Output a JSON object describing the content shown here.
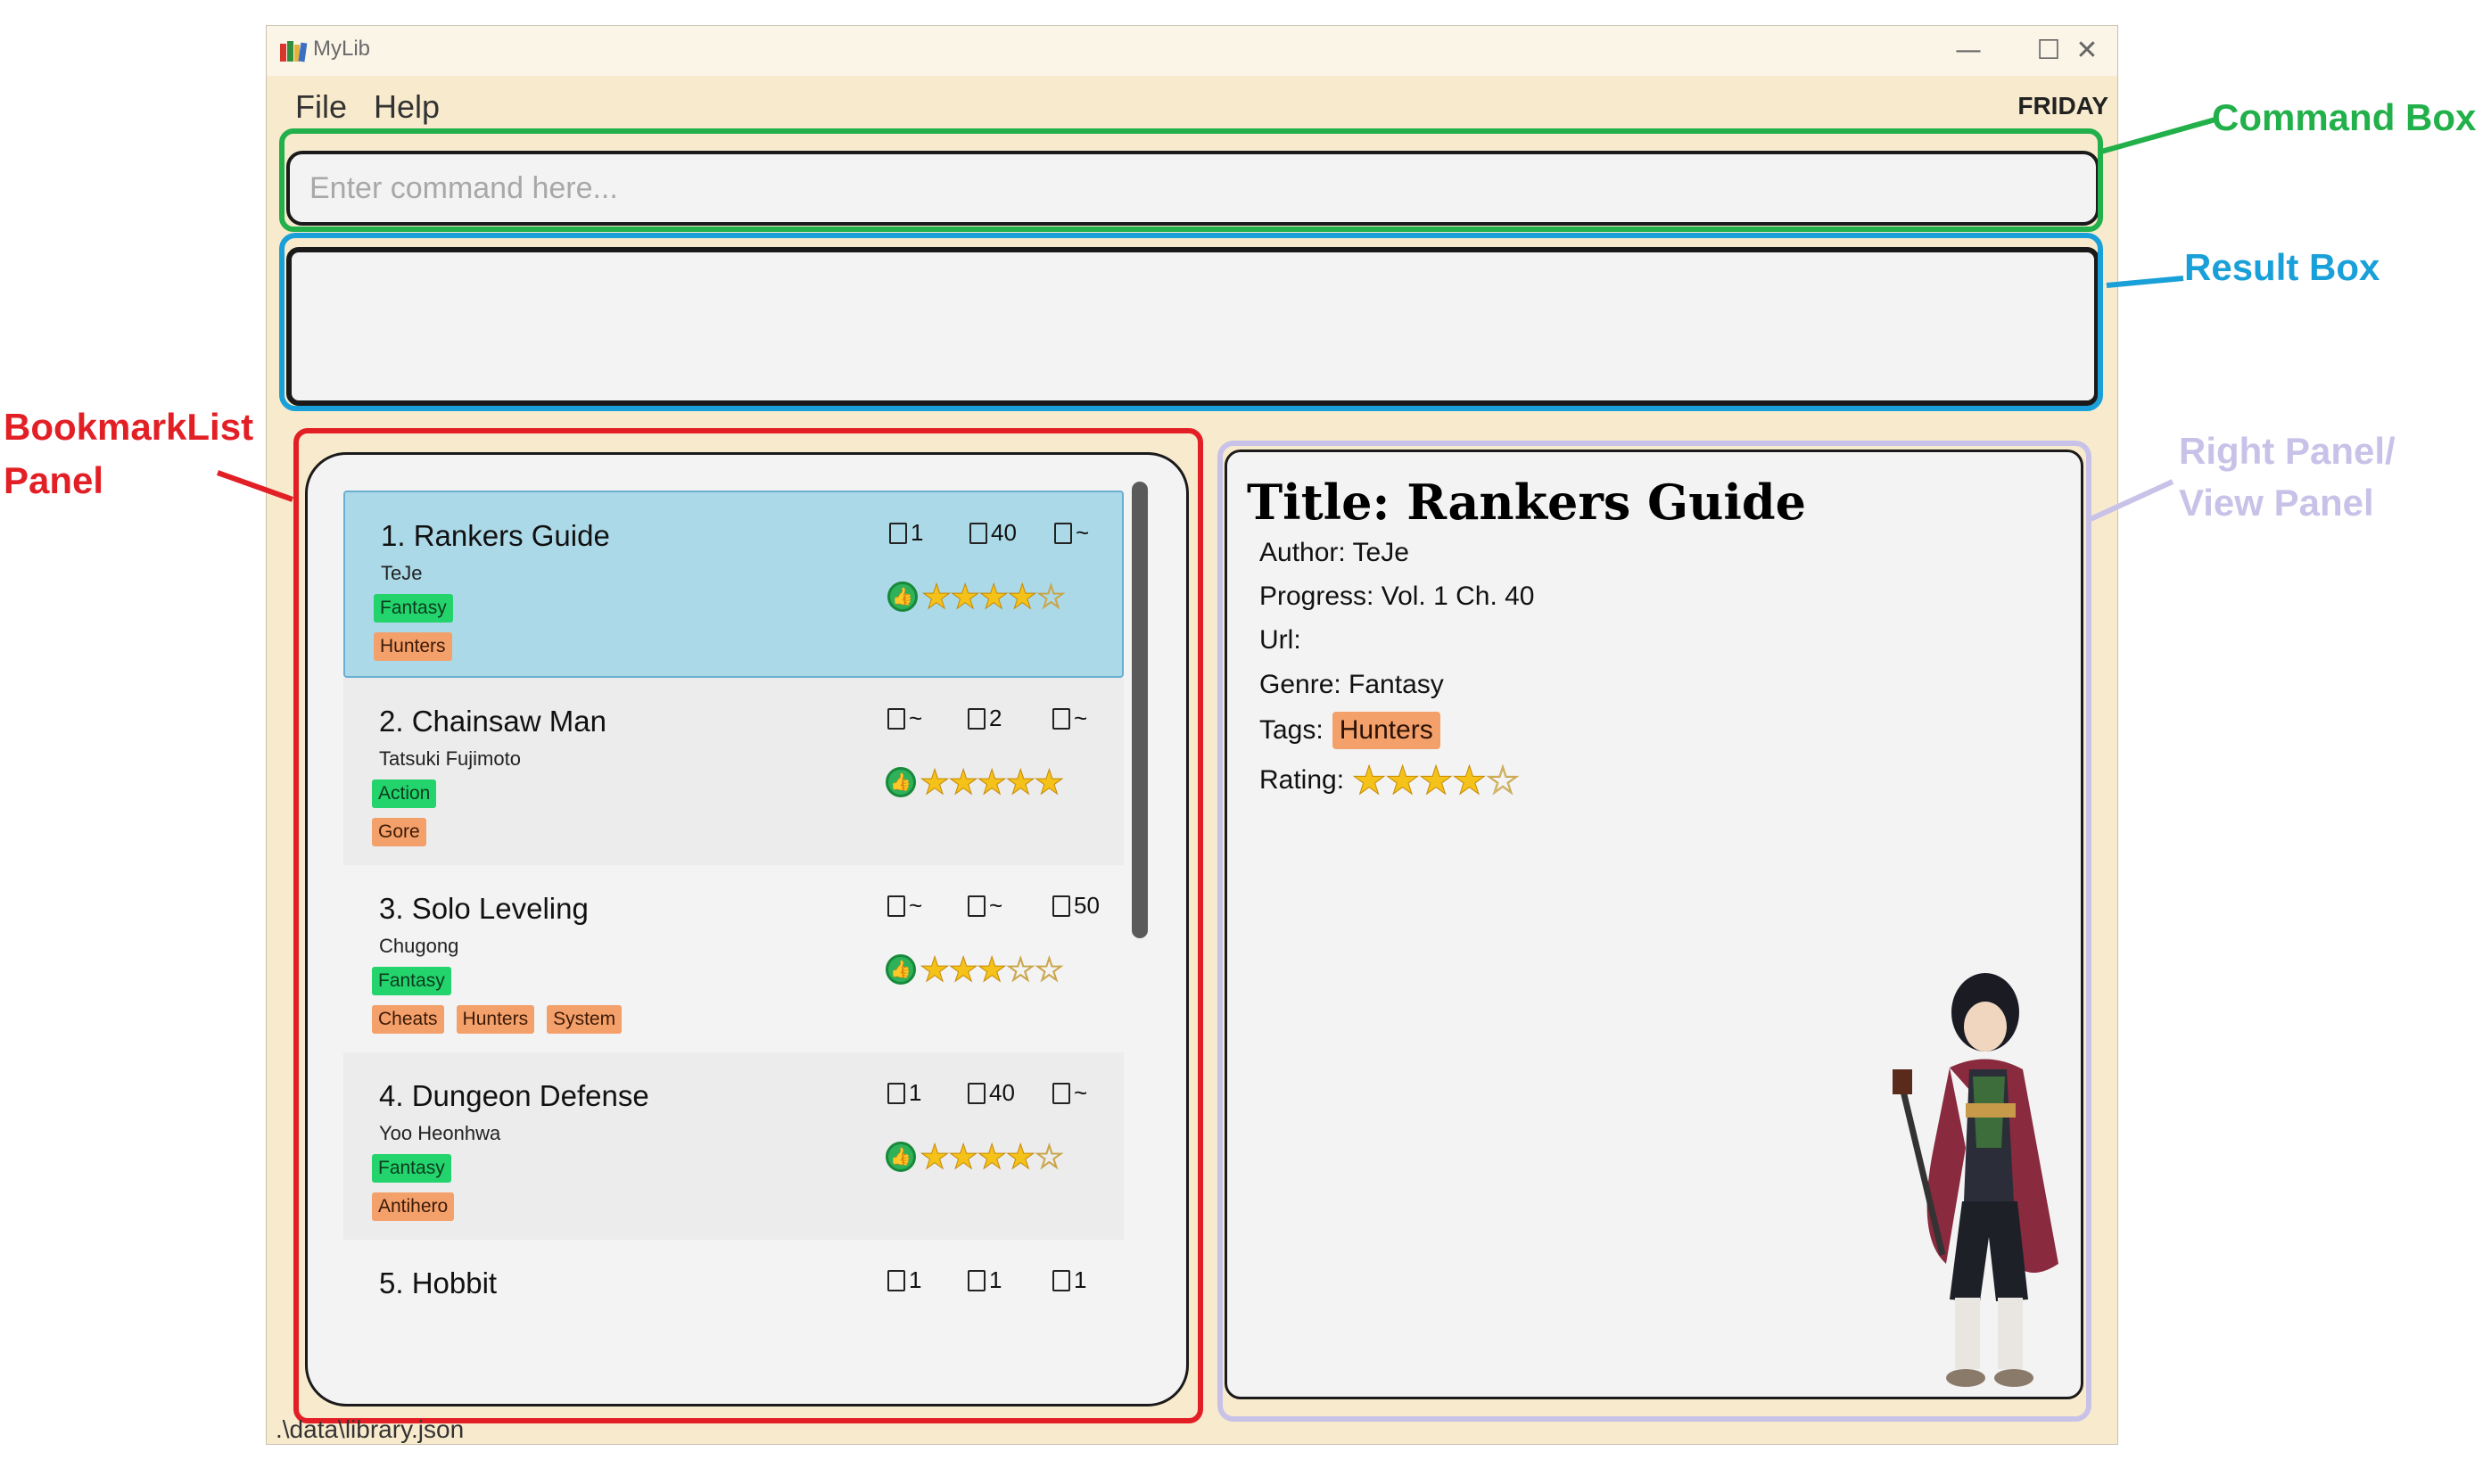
{
  "window": {
    "title": "MyLib",
    "controls": {
      "minimize": "—",
      "maximize": "☐",
      "close": "✕"
    }
  },
  "menu": {
    "file": "File",
    "help": "Help"
  },
  "theme_label": "FRIDAY",
  "command_box": {
    "placeholder": "Enter command here...",
    "value": ""
  },
  "result_box": {
    "text": ""
  },
  "bookmarks": [
    {
      "index_title": "1. Rankers Guide",
      "author": "TeJe",
      "genre": "Fantasy",
      "tags": [
        "Hunters"
      ],
      "volume": "1",
      "chapter": "40",
      "page": "~",
      "rating": 4,
      "selected": true
    },
    {
      "index_title": "2. Chainsaw Man",
      "author": "Tatsuki Fujimoto",
      "genre": "Action",
      "tags": [
        "Gore"
      ],
      "volume": "~",
      "chapter": "2",
      "page": "~",
      "rating": 5,
      "selected": false
    },
    {
      "index_title": "3. Solo Leveling",
      "author": "Chugong",
      "genre": "Fantasy",
      "tags": [
        "Cheats",
        "Hunters",
        "System"
      ],
      "volume": "~",
      "chapter": "~",
      "page": "50",
      "rating": 3,
      "selected": false
    },
    {
      "index_title": "4. Dungeon Defense",
      "author": "Yoo Heonhwa",
      "genre": "Fantasy",
      "tags": [
        "Antihero"
      ],
      "volume": "1",
      "chapter": "40",
      "page": "~",
      "rating": 4,
      "selected": false
    },
    {
      "index_title": "5. Hobbit",
      "author": "",
      "genre": "",
      "tags": [],
      "volume": "1",
      "chapter": "1",
      "page": "1",
      "rating": 0,
      "selected": false
    }
  ],
  "view_panel": {
    "title": "Title: Rankers Guide",
    "author": "Author: TeJe",
    "progress": "Progress: Vol. 1 Ch. 40",
    "url": "Url:",
    "genre": "Genre: Fantasy",
    "tags_label": "Tags:",
    "tag": "Hunters",
    "rating_label": "Rating:",
    "rating": 4
  },
  "status_bar": {
    "path": ".\\data\\library.json"
  },
  "annotations": {
    "command_box": "Command Box",
    "result_box": "Result Box",
    "bookmark_list_line1": "BookmarkList",
    "bookmark_list_line2": "Panel",
    "right_panel_line1": "Right Panel/",
    "right_panel_line2": "View Panel"
  },
  "colors": {
    "window_bg": "#f8ebcd",
    "selected_card": "#acd9e8",
    "genre_chip": "#22d46b",
    "tag_chip": "#f4a06a",
    "command_outline": "#22b04a",
    "result_outline": "#1aa0d8",
    "list_outline": "#e31f26",
    "view_outline": "#c9c2e8",
    "star": "#f5c21a"
  }
}
